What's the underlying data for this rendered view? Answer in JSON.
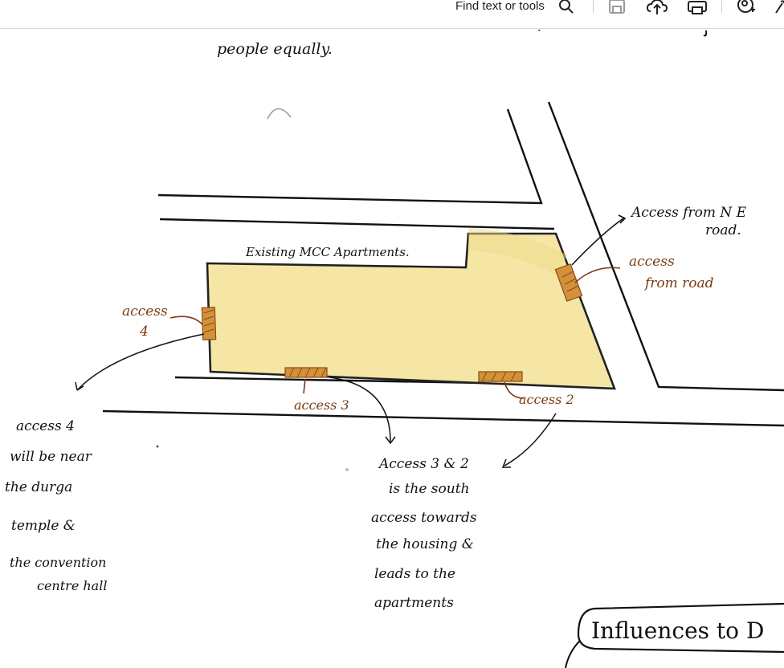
{
  "toolbar": {
    "find_label": "Find text or tools",
    "icons": [
      "search-icon",
      "save-icon",
      "cloud-upload-icon",
      "print-icon",
      "user-add-icon",
      "link-icon"
    ]
  },
  "document": {
    "top_fragment": "people equally.",
    "site_label": "Existing MCC Apartments.",
    "access_ne_line1": "Access from N E",
    "access_ne_line2": "road.",
    "access_road_line1": "access",
    "access_road_line2": "from road",
    "access4_line1": "access",
    "access4_line2": "4",
    "access3": "access 3",
    "access2": "access 2",
    "note_access4": [
      "access 4",
      "will be near",
      "the durga",
      "temple &",
      "the convention",
      "centre hall"
    ],
    "note_access32": [
      "Access 3 & 2",
      "is the south",
      "access towards",
      "the housing &",
      "leads to the",
      "apartments"
    ],
    "callout": "Influences to D"
  },
  "colors": {
    "site_fill": "#f5e6a6",
    "hatch": "#c77f2a",
    "ink": "#111111",
    "brown_ink": "#7a3a10"
  }
}
